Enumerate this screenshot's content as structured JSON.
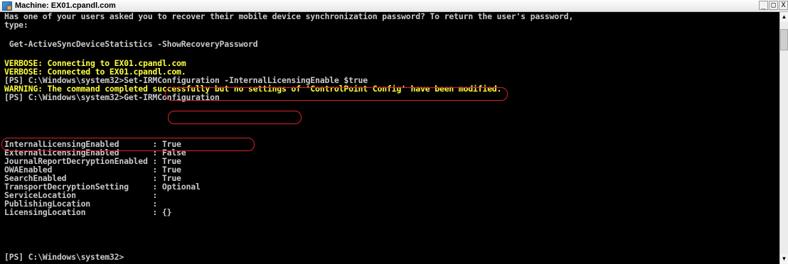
{
  "window": {
    "title": "Machine: EX01.cpandl.com",
    "minimize": "_",
    "restore": "□",
    "close": "X"
  },
  "console": {
    "lines": [
      "Has one of your users asked you to recover their mobile device synchronization password? To return the user's password,",
      "type:",
      "",
      " Get-ActiveSyncDeviceStatistics -ShowRecoveryPassword",
      "",
      "VERBOSE: Connecting to EX01.cpandl.com",
      "VERBOSE: Connected to EX01.cpandl.com.",
      "[PS] C:\\Windows\\system32>Set-IRMConfiguration -InternalLicensingEnable $true",
      "WARNING: The command completed successfully but no settings of 'ControlPoint Config' have been modified.",
      "[PS] C:\\Windows\\system32>Get-IRMConfiguration",
      "",
      "",
      "InternalLicensingEnabled       : True",
      "ExternalLicensingEnabled       : False",
      "JournalReportDecryptionEnabled : True",
      "OWAEnabled                     : True",
      "SearchEnabled                  : True",
      "TransportDecryptionSetting     : Optional",
      "ServiceLocation                :",
      "PublishingLocation             :",
      "LicensingLocation              : {}",
      "",
      "",
      "",
      "[PS] C:\\Windows\\system32>"
    ]
  },
  "colors": {
    "background": "#000000",
    "normal_text": "#c9c9c9",
    "verbose_warning_text": "#ffff3c",
    "annotation": "#d8232a"
  },
  "icons": {
    "app": "powershell-console-icon",
    "scroll_up": "▲",
    "scroll_down": "▼"
  }
}
